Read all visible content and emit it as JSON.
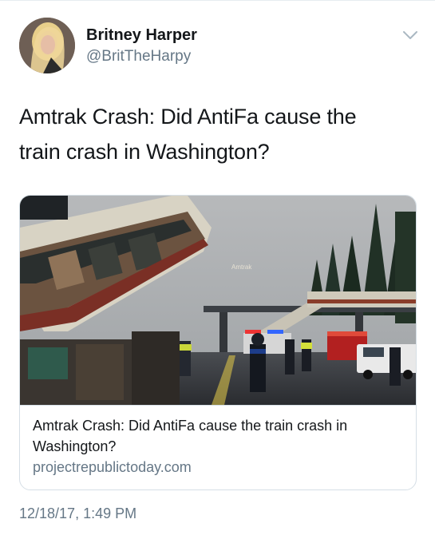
{
  "author": {
    "display_name": "Britney Harper",
    "handle": "@BritTheHarpy",
    "avatar_icon": "profile-photo"
  },
  "menu": {
    "icon": "chevron-down-icon"
  },
  "tweet": {
    "text": "Amtrak Crash: Did AntiFa cause the train crash in Washington?",
    "timestamp": "12/18/17, 1:49 PM"
  },
  "link_card": {
    "image_alt": "Derailed Amtrak train car hanging from an overpass with police and emergency vehicles on the road below",
    "image_text": "Amtrak",
    "title": "Amtrak Crash: Did AntiFa cause the train crash in Washington?",
    "domain": "projectrepublictoday.com"
  },
  "colors": {
    "text_primary": "#14171a",
    "text_secondary": "#657786",
    "border": "#d6dfe6"
  }
}
